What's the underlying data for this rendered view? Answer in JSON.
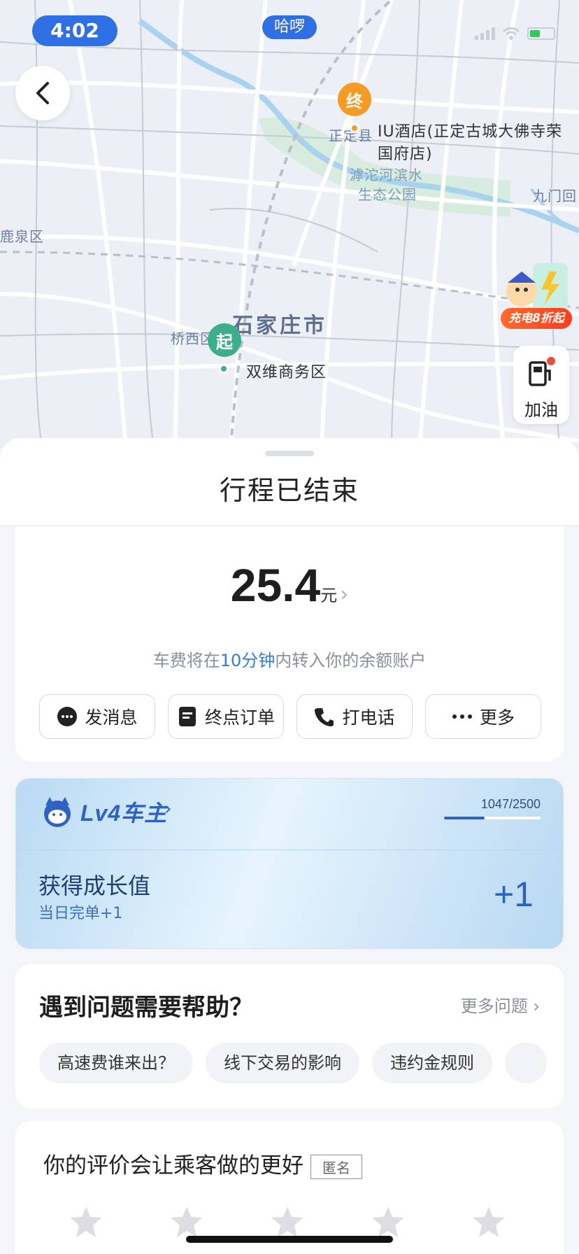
{
  "status_bar": {
    "time": "4:02",
    "app_label": "哈啰"
  },
  "map": {
    "labels": {
      "end_poi": "IU酒店(正定古城大佛寺荣",
      "end_poi_line2": "国府店)",
      "zhengding": "正定县",
      "park_line1": "滹沱河滨水",
      "park_line2": "生态公园",
      "jiumen": "九门回",
      "luquan": "鹿泉区",
      "city": "石家庄市",
      "qiaoxi": "桥西区",
      "start_poi": "双维商务区"
    },
    "end_marker": "终",
    "start_marker": "起",
    "promo_badge": "充电8折起",
    "fuel_label": "加油"
  },
  "sheet": {
    "title": "行程已结束"
  },
  "fare": {
    "amount": "25.4",
    "unit": "元",
    "note_prefix": "车费将在",
    "note_highlight": "10分钟",
    "note_suffix": "内转入你的余额账户",
    "actions": [
      "发消息",
      "终点订单",
      "打电话",
      "更多"
    ]
  },
  "level": {
    "title": "Lv4车主",
    "progress_text": "1047/2500",
    "progress_fraction": 0.4188,
    "growth_title": "获得成长值",
    "growth_sub": "当日完单+1",
    "growth_value": "+1"
  },
  "help": {
    "title": "遇到问题需要帮助？",
    "more": "更多问题",
    "chips": [
      "高速费谁来出？",
      "线下交易的影响",
      "违约金规则"
    ]
  },
  "rating": {
    "title": "你的评价会让乘客做的更好",
    "badge": "匿名",
    "star_count": 5
  },
  "colors": {
    "accent": "#2f7de1",
    "end_pin": "#f59a23",
    "start_pin": "#3cae8a"
  }
}
